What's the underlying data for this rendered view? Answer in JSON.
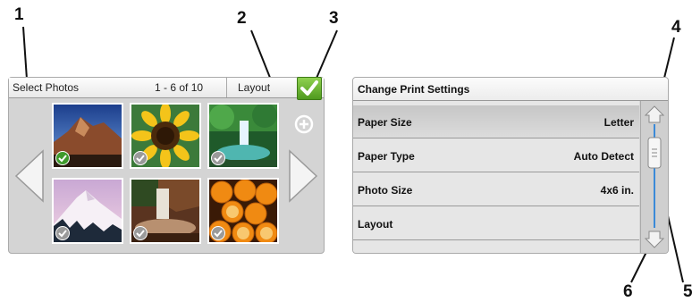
{
  "callouts": [
    "1",
    "2",
    "3",
    "4",
    "5",
    "6"
  ],
  "select_photos": {
    "title": "Select Photos",
    "count": "1 - 6 of 10",
    "layout_label": "Layout",
    "ok_icon": "checkmark-icon",
    "zoom_icon": "zoom-in-icon",
    "photos": [
      {
        "name": "mountain-peak",
        "selected": true
      },
      {
        "name": "sunflower",
        "selected": false
      },
      {
        "name": "waterfall-forest",
        "selected": false
      },
      {
        "name": "snowy-mountain",
        "selected": false
      },
      {
        "name": "waterfall-rocks",
        "selected": false
      },
      {
        "name": "oranges",
        "selected": false
      }
    ],
    "colors": {
      "ok_green": "#5aa626",
      "checked": "#3f9a2c",
      "unchecked": "#9a9a9a"
    }
  },
  "print_settings": {
    "title": "Change Print Settings",
    "rows": [
      {
        "label": "Paper Size",
        "value": "Letter",
        "selected": true
      },
      {
        "label": "Paper Type",
        "value": "Auto Detect",
        "selected": false
      },
      {
        "label": "Photo Size",
        "value": "4x6 in.",
        "selected": false
      },
      {
        "label": "Layout",
        "value": "",
        "selected": false
      }
    ],
    "scroll_position": 0.25
  }
}
